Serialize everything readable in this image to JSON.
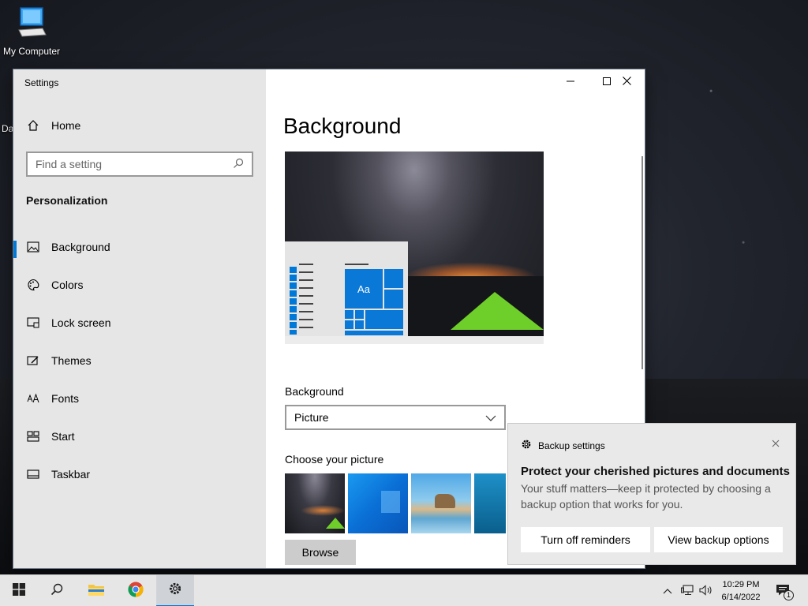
{
  "desktop": {
    "icons": [
      {
        "label": "My Computer",
        "icon": "computer-icon"
      }
    ],
    "partial_icon_label": "Da"
  },
  "window": {
    "title": "Settings",
    "controls": {
      "minimize": "minimize-icon",
      "maximize": "maximize-icon",
      "close": "close-icon"
    }
  },
  "nav": {
    "home_label": "Home",
    "search_placeholder": "Find a setting",
    "section_title": "Personalization",
    "items": [
      {
        "label": "Background",
        "icon": "picture-icon",
        "active": true
      },
      {
        "label": "Colors",
        "icon": "palette-icon",
        "active": false
      },
      {
        "label": "Lock screen",
        "icon": "lock-screen-icon",
        "active": false
      },
      {
        "label": "Themes",
        "icon": "themes-icon",
        "active": false
      },
      {
        "label": "Fonts",
        "icon": "fonts-icon",
        "active": false
      },
      {
        "label": "Start",
        "icon": "start-icon",
        "active": false
      },
      {
        "label": "Taskbar",
        "icon": "taskbar-icon",
        "active": false
      }
    ]
  },
  "main": {
    "page_title": "Background",
    "preview_tile_text": "Aa",
    "background_label": "Background",
    "background_value": "Picture",
    "choose_label": "Choose your picture",
    "browse_label": "Browse"
  },
  "toast": {
    "app_name": "Backup settings",
    "title": "Protect your cherished pictures and documents",
    "body": "Your stuff matters—keep it protected by choosing a backup option that works for you.",
    "buttons": [
      "Turn off reminders",
      "View backup options"
    ]
  },
  "taskbar": {
    "items": [
      "start-icon",
      "search-icon",
      "file-explorer-icon",
      "chrome-icon",
      "settings-icon"
    ],
    "time": "10:29 PM",
    "date": "6/14/2022",
    "notification_count": "1"
  },
  "colors": {
    "accent": "#0078d7",
    "nav_bg": "#e6e6e6",
    "toast_bg": "#e9e9e9",
    "tent": "#6fcf2a"
  }
}
